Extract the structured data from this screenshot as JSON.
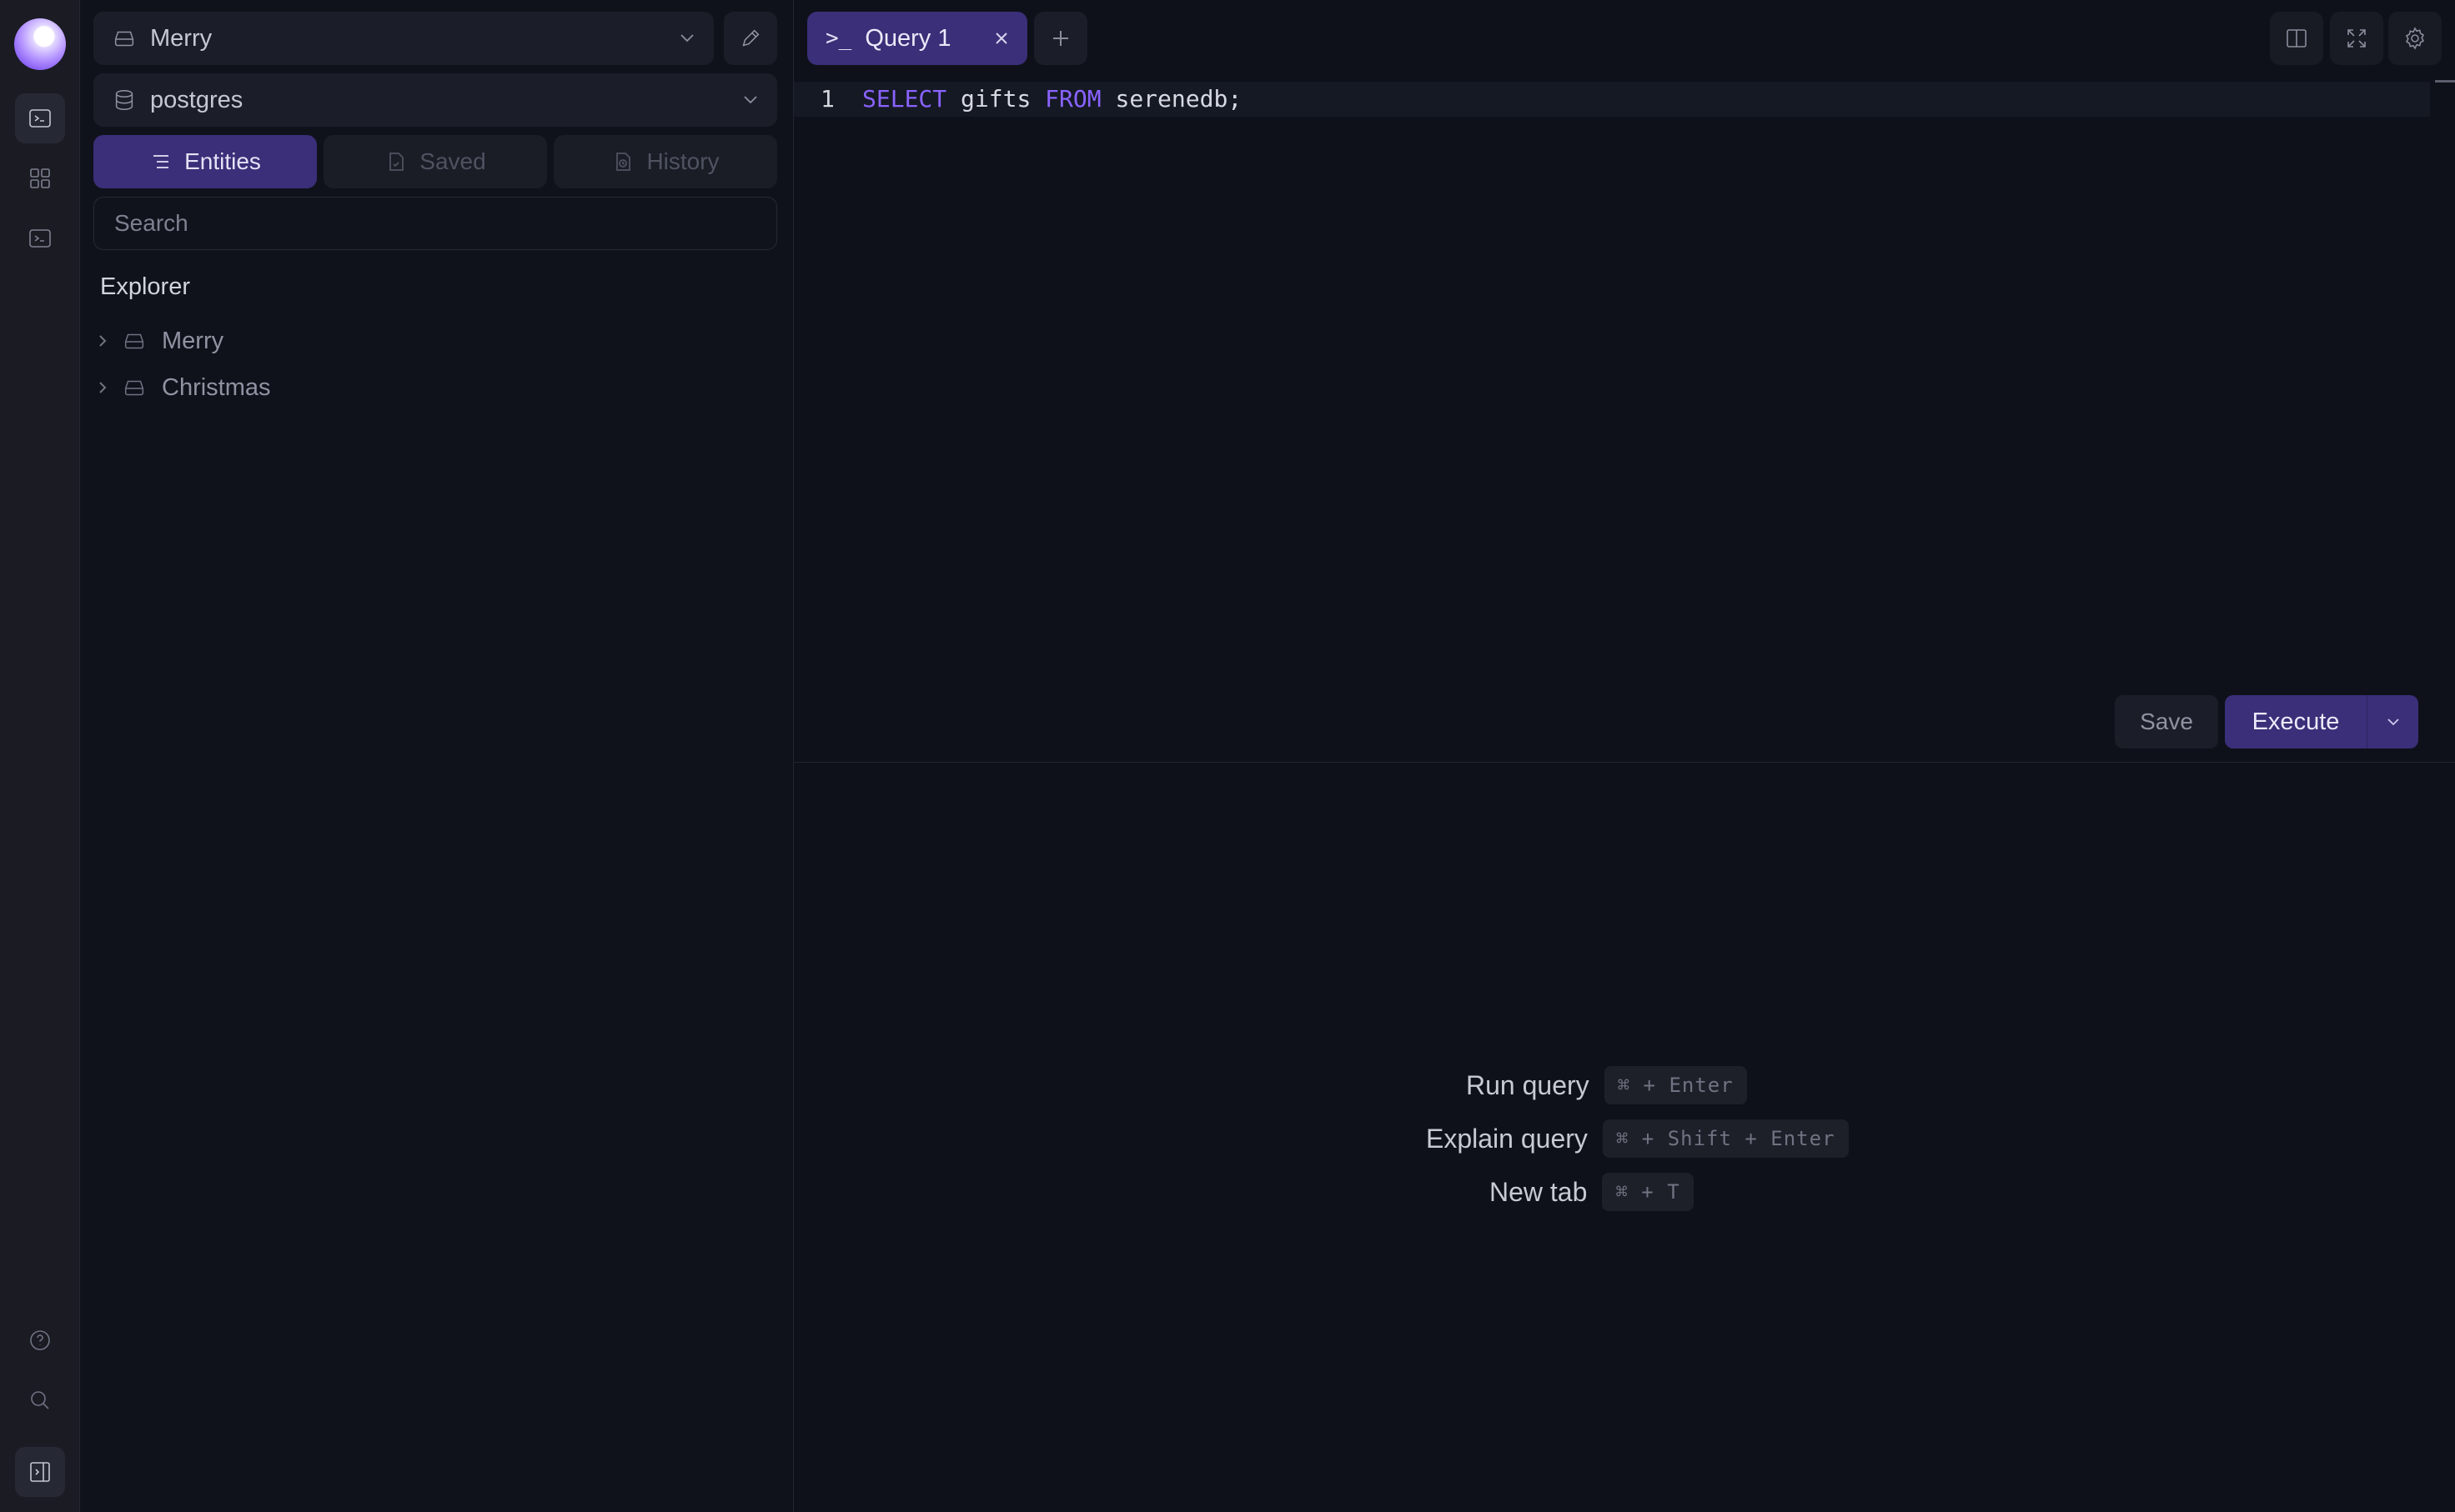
{
  "sidebar": {
    "connection": {
      "label": "Merry",
      "icon": "database-drive-icon"
    },
    "database": {
      "label": "postgres",
      "icon": "database-icon"
    },
    "tabs": [
      {
        "label": "Entities",
        "icon": "list-icon",
        "active": true
      },
      {
        "label": "Saved",
        "icon": "saved-file-icon",
        "active": false
      },
      {
        "label": "History",
        "icon": "history-icon",
        "active": false
      }
    ],
    "search": {
      "placeholder": "Search",
      "value": ""
    },
    "explorer": {
      "title": "Explorer",
      "items": [
        {
          "label": "Merry",
          "icon": "database-drive-icon"
        },
        {
          "label": "Christmas",
          "icon": "database-drive-icon"
        }
      ]
    }
  },
  "editor": {
    "tab": {
      "prompt": ">_",
      "label": "Query 1"
    },
    "line_number": "1",
    "code": {
      "kw1": "SELECT",
      "part1": " gifts ",
      "kw2": "FROM",
      "part2": " serenedb;"
    },
    "save_label": "Save",
    "execute_label": "Execute"
  },
  "shortcuts": [
    {
      "label": "Run query",
      "keys": "⌘ + Enter"
    },
    {
      "label": "Explain query",
      "keys": "⌘ + Shift + Enter"
    },
    {
      "label": "New tab",
      "keys": "⌘ + T"
    }
  ],
  "colors": {
    "accent": "#3a2f78",
    "keyword": "#8a63ff",
    "background": "#0e111a"
  }
}
